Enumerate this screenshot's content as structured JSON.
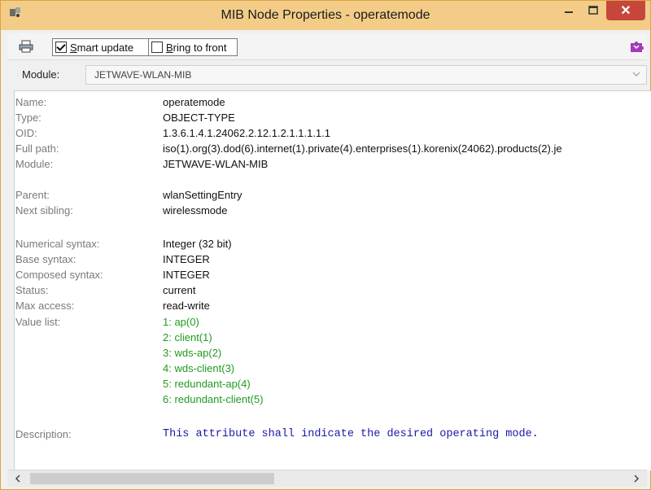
{
  "window": {
    "title": "MIB Node Properties - operatemode",
    "close_label": "✕"
  },
  "toolbar": {
    "smart_update": {
      "pre": "",
      "key": "S",
      "post": "mart update",
      "checked": true
    },
    "bring_to_front": {
      "pre": "",
      "key": "B",
      "post": "ring to front",
      "checked": false
    }
  },
  "module_bar": {
    "label": "Module:",
    "value": "JETWAVE-WLAN-MIB"
  },
  "properties": {
    "name": {
      "label": "Name:",
      "value": "operatemode"
    },
    "type": {
      "label": "Type:",
      "value": "OBJECT-TYPE"
    },
    "oid": {
      "label": "OID:",
      "value": "1.3.6.1.4.1.24062.2.12.1.2.1.1.1.1.1"
    },
    "full_path": {
      "label": "Full path:",
      "value": "iso(1).org(3).dod(6).internet(1).private(4).enterprises(1).korenix(24062).products(2).je"
    },
    "module": {
      "label": "Module:",
      "value": "JETWAVE-WLAN-MIB"
    },
    "parent": {
      "label": "Parent:",
      "value": "wlanSettingEntry"
    },
    "next_sibling": {
      "label": "Next sibling:",
      "value": "wirelessmode"
    },
    "numerical_syntax": {
      "label": "Numerical syntax:",
      "value": "Integer (32 bit)"
    },
    "base_syntax": {
      "label": "Base syntax:",
      "value": "INTEGER"
    },
    "composed_syntax": {
      "label": "Composed syntax:",
      "value": "INTEGER"
    },
    "status": {
      "label": "Status:",
      "value": "current"
    },
    "max_access": {
      "label": "Max access:",
      "value": "read-write"
    },
    "value_list": {
      "label": "Value list:",
      "items": [
        "1: ap(0)",
        "2: client(1)",
        "3: wds-ap(2)",
        "4: wds-client(3)",
        "5: redundant-ap(4)",
        "6: redundant-client(5)"
      ]
    },
    "description": {
      "label": "Description:",
      "value": "This attribute shall indicate the desired operating mode."
    }
  },
  "colors": {
    "titlebar": "#f3cd88",
    "close_button": "#c7463b",
    "value_list_text": "#1f9b1f",
    "description_text": "#1a1aa8",
    "label_text": "#7a7a7a"
  },
  "icons": [
    "app-icon",
    "minimize-icon",
    "maximize-icon",
    "close-icon",
    "printer-icon",
    "extension-icon",
    "chevron-down-icon",
    "scroll-left-icon",
    "scroll-right-icon"
  ]
}
